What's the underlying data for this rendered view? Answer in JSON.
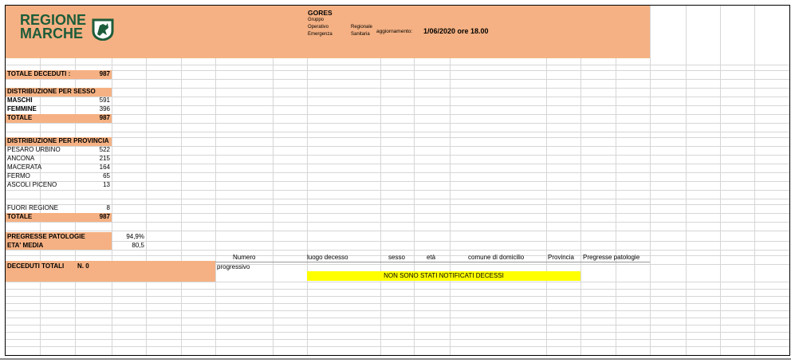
{
  "header": {
    "logo_line1": "REGIONE",
    "logo_line2": "MARCHE",
    "org_title": "GORES",
    "org_line1": "Gruppo",
    "org_line2": "Operativo",
    "org_line3": "Emergenza",
    "org_regionale": "Regionale",
    "org_sanitaria": "Sanitaria",
    "update_label": "aggiornamento:",
    "update_value": "1/06/2020 ore 18.00"
  },
  "totale_deceduti": {
    "label": "TOTALE DECEDUTI :",
    "value": "987"
  },
  "sesso": {
    "title": "DISTRIBUZIONE PER SESSO",
    "rows": [
      {
        "label": "MASCHI",
        "value": "591"
      },
      {
        "label": "FEMMINE",
        "value": "396"
      }
    ],
    "total_label": "TOTALE",
    "total_value": "987"
  },
  "provincia": {
    "title": "DISTRIBUZIONE PER PROVINCIA",
    "rows": [
      {
        "label": "PESARO URBINO",
        "value": "522"
      },
      {
        "label": "ANCONA",
        "value": "215"
      },
      {
        "label": "MACERATA",
        "value": "164"
      },
      {
        "label": "FERMO",
        "value": "65"
      },
      {
        "label": "ASCOLI PICENO",
        "value": "13"
      }
    ],
    "fuori_label": "FUORI REGIONE",
    "fuori_value": "8",
    "total_label": "TOTALE",
    "total_value": "987"
  },
  "stats": {
    "pregresse_label": "PREGRESSE PATOLOGIE",
    "pregresse_value": "94,9%",
    "eta_label": "ETA' MEDIA",
    "eta_value": "80,5"
  },
  "deceduti_totali": {
    "label": "DECEDUTI TOTALI",
    "value": "N. 0"
  },
  "table": {
    "col_numero_1": "Numero",
    "col_numero_2": "progressivo",
    "col_luogo": "luogo decesso",
    "col_sesso": "sesso",
    "col_eta": "età",
    "col_comune": "comune di domicilio",
    "col_provincia": "Provincia",
    "col_pregresse": "Pregresse patologie",
    "notice": "NON SONO STATI NOTIFICATI DECESSI"
  },
  "colors": {
    "fill": "#f5b183",
    "notice": "#ffff00",
    "logo_text": "#1d5c3a"
  },
  "icons": {
    "logo": "regione-marche-emblem-icon"
  }
}
